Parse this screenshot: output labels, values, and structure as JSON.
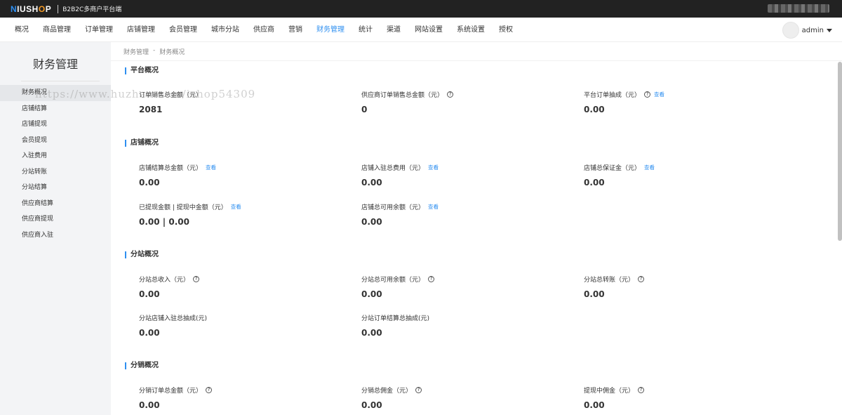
{
  "topbar": {
    "logo_n": "N",
    "logo_iushop": "IUSH",
    "logo_o": "O",
    "logo_p": "P",
    "platform": "B2B2C多商户平台端"
  },
  "nav": [
    "概况",
    "商品管理",
    "订单管理",
    "店铺管理",
    "会员管理",
    "城市分站",
    "供应商",
    "营销",
    "财务管理",
    "统计",
    "渠道",
    "网站设置",
    "系统设置",
    "授权"
  ],
  "nav_active_index": 8,
  "user": {
    "name": "admin"
  },
  "sidebar": {
    "title": "财务管理",
    "items": [
      "财务概况",
      "店铺结算",
      "店铺提现",
      "会员提现",
      "入驻费用",
      "分站转账",
      "分站结算",
      "供应商结算",
      "供应商提现",
      "供应商入驻"
    ]
  },
  "breadcrumb": [
    "财务管理",
    "-",
    "财务概况"
  ],
  "watermark": "https://www.huzhan.com/ishop54309",
  "sections": {
    "platform": {
      "title": "平台概况",
      "m1": {
        "label": "订单销售总金额（元）",
        "value": "2081"
      },
      "m2": {
        "label": "供应商订单销售总金额（元）",
        "value": "0"
      },
      "m3": {
        "label": "平台订单抽成（元）",
        "link": "查看",
        "value": "0.00"
      }
    },
    "shop": {
      "title": "店铺概况",
      "m1": {
        "label": "店铺结算总金额（元）",
        "link": "查看",
        "value": "0.00"
      },
      "m2": {
        "label": "店铺入驻总费用（元）",
        "link": "查看",
        "value": "0.00"
      },
      "m3": {
        "label": "店铺总保证金（元）",
        "link": "查看",
        "value": "0.00"
      },
      "m4": {
        "label": "已提现金额 | 提现中金额（元）",
        "link": "查看",
        "value": "0.00 | 0.00"
      },
      "m5": {
        "label": "店铺总可用余额（元）",
        "link": "查看",
        "value": "0.00"
      }
    },
    "substation": {
      "title": "分站概况",
      "m1": {
        "label": "分站总收入（元）",
        "value": "0.00"
      },
      "m2": {
        "label": "分站总可用余额（元）",
        "value": "0.00"
      },
      "m3": {
        "label": "分站总转账（元）",
        "value": "0.00"
      },
      "m4": {
        "label": "分站店铺入驻总抽成(元)",
        "value": "0.00"
      },
      "m5": {
        "label": "分站订单结算总抽成(元)",
        "value": "0.00"
      }
    },
    "distribution": {
      "title": "分销概况",
      "m1": {
        "label": "分销订单总金额（元）",
        "value": "0.00"
      },
      "m2": {
        "label": "分销总佣金（元）",
        "value": "0.00"
      },
      "m3": {
        "label": "提现中佣金（元）",
        "value": "0.00"
      }
    }
  },
  "help_glyph": "?",
  "colors": {
    "accent": "#2e8ff0",
    "topbar": "#222222",
    "logo_o": "#f59a23"
  }
}
